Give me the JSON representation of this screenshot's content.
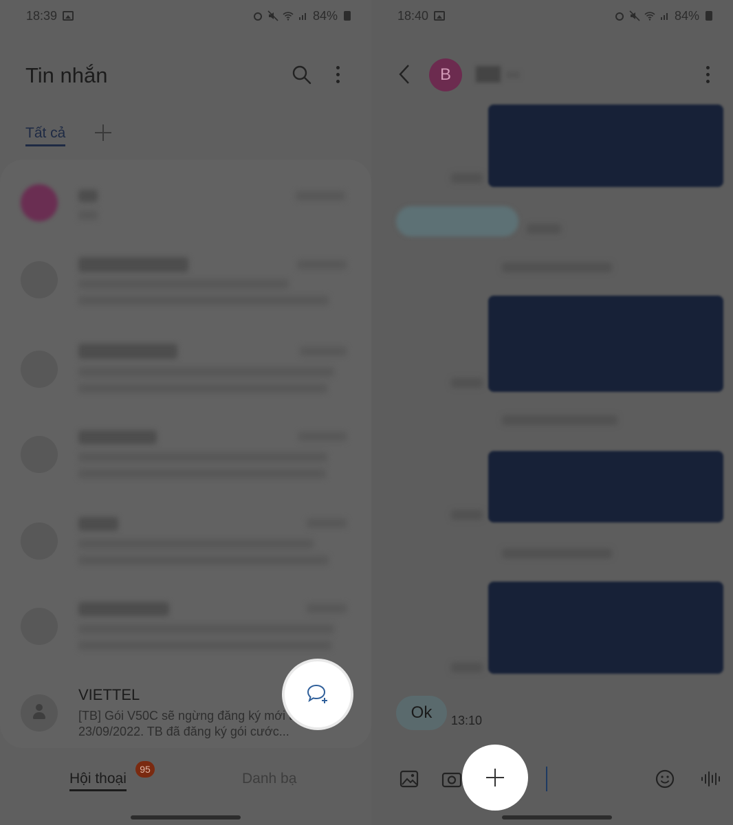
{
  "left_screen": {
    "status": {
      "time": "18:39",
      "battery": "84%"
    },
    "header": {
      "title": "Tin nhắn"
    },
    "tabs": {
      "all_label": "Tất cả"
    },
    "conversations": [
      {
        "name": "VIETTEL",
        "preview": "[TB] Gói V50C sẽ ngừng đăng ký mới từ ngày 23/09/2022. TB đã đăng ký gói cước..."
      }
    ],
    "bottom_nav": {
      "conversations_label": "Hội thoại",
      "badge_count": "95",
      "contacts_label": "Danh bạ"
    },
    "icons": [
      "search-icon",
      "more-vert-icon",
      "add-tab-icon",
      "new-message-icon",
      "person-icon"
    ]
  },
  "right_screen": {
    "status": {
      "time": "18:40",
      "battery": "84%"
    },
    "contact": {
      "avatar_letter": "B"
    },
    "last_message": {
      "text": "Ok",
      "time": "13:10"
    },
    "icons": [
      "back-icon",
      "more-vert-icon",
      "gallery-icon",
      "camera-icon",
      "plus-icon",
      "emoji-icon",
      "voice-icon"
    ]
  },
  "colors": {
    "accent": "#1e2a44",
    "badge": "#7a2a10",
    "avatar": "#6c2b4f",
    "outgoing_bubble": "#172137"
  }
}
